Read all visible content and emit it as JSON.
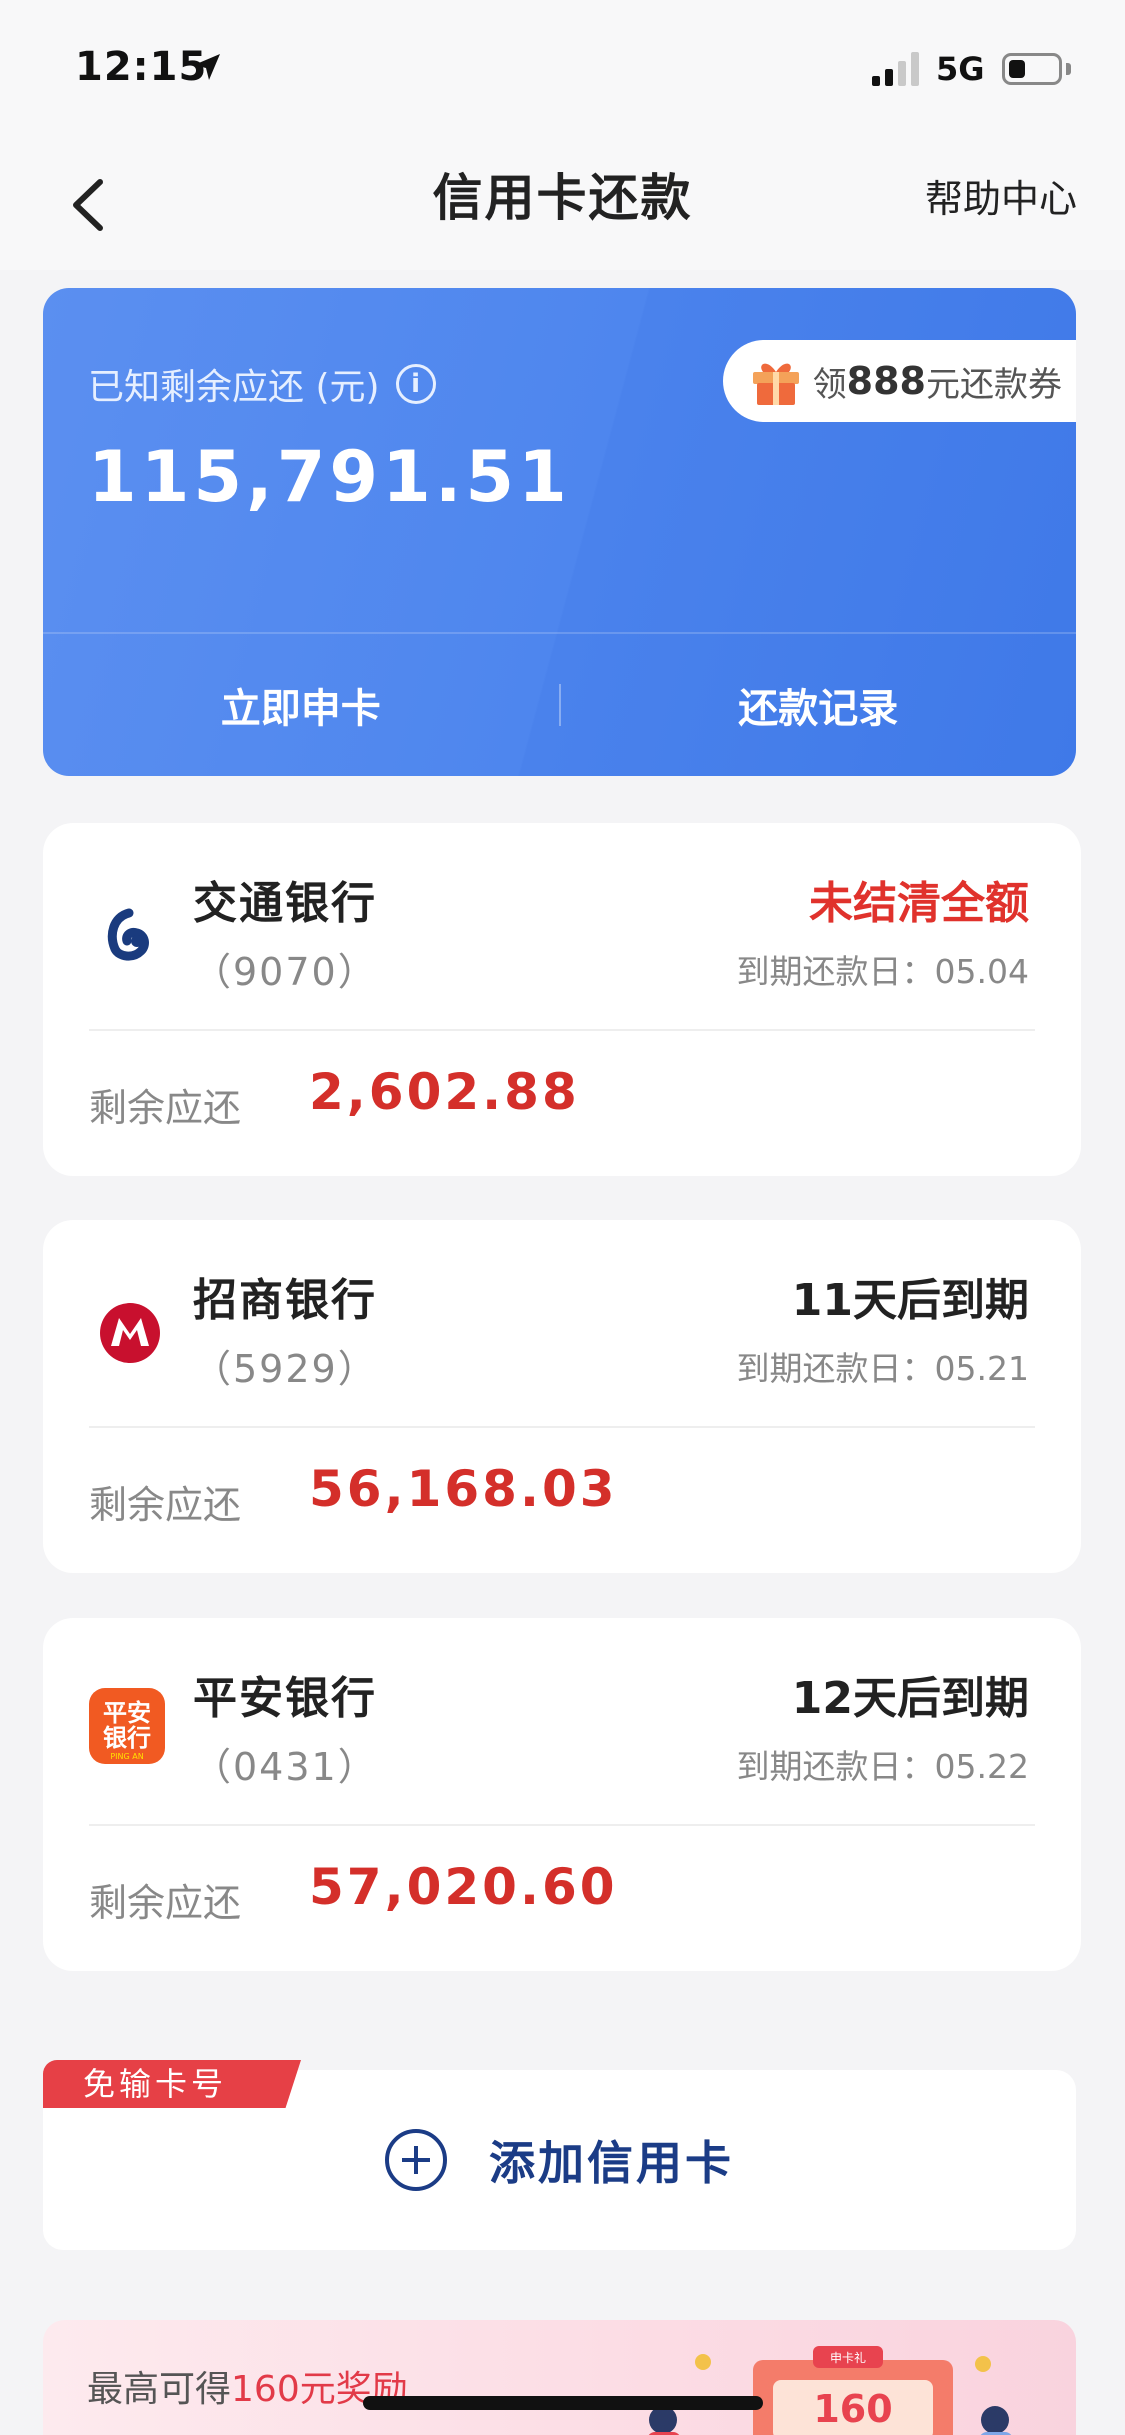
{
  "status_bar": {
    "time": "12:15",
    "network": "5G"
  },
  "nav": {
    "title": "信用卡还款",
    "help": "帮助中心"
  },
  "summary": {
    "label": "已知剩余应还 (元)",
    "amount": "115,791.51",
    "coupon_prefix": "领",
    "coupon_amount": "888",
    "coupon_suffix": "元还款券",
    "actions": [
      "立即申卡",
      "还款记录"
    ]
  },
  "cards": [
    {
      "bank": "交通银行",
      "tail": "（9070）",
      "status": "未结清全额",
      "status_color": "#e0322c",
      "due": "到期还款日：05.04",
      "remain_label": "剩余应还",
      "remain": "2,602.88"
    },
    {
      "bank": "招商银行",
      "tail": "（5929）",
      "status": "11天后到期",
      "status_color": "#222222",
      "due": "到期还款日：05.21",
      "remain_label": "剩余应还",
      "remain": "56,168.03"
    },
    {
      "bank": "平安银行",
      "tail": "（0431）",
      "status": "12天后到期",
      "status_color": "#222222",
      "due": "到期还款日：05.22",
      "remain_label": "剩余应还",
      "remain": "57,020.60",
      "logo_text": [
        "平安",
        "银行",
        "PING AN"
      ]
    }
  ],
  "add_card": {
    "badge": "免输卡号",
    "label": "添加信用卡"
  },
  "promo": {
    "title_prefix": "最高可得",
    "title_highlight": "160元奖励",
    "badge_amount": "160",
    "badge_tag": "申卡礼"
  },
  "colors": {
    "primary_blue": "#4e86ee",
    "accent_red": "#d42f2a",
    "navy": "#1b3c86"
  }
}
